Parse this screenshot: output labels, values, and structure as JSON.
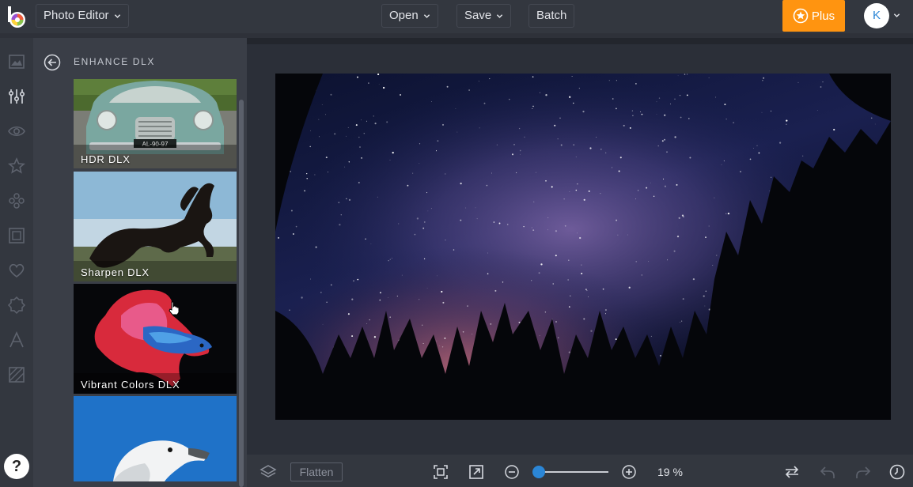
{
  "header": {
    "app_menu_label": "Photo Editor",
    "open_label": "Open",
    "save_label": "Save",
    "batch_label": "Batch",
    "plus_label": "Plus",
    "avatar_initial": "K"
  },
  "sidebar": {
    "icons": [
      "image-icon",
      "adjust-sliders-icon",
      "eye-icon",
      "star-icon",
      "overlay-dots-icon",
      "frame-icon",
      "heart-icon",
      "badge-icon",
      "text-icon",
      "texture-icon"
    ],
    "help_label": "?"
  },
  "panel": {
    "title": "ENHANCE DLX",
    "items": [
      {
        "label": "HDR DLX"
      },
      {
        "label": "Sharpen DLX"
      },
      {
        "label": "Vibrant Colors DLX"
      },
      {
        "label": ""
      }
    ]
  },
  "bottombar": {
    "flatten_label": "Flatten",
    "zoom_text": "19 %",
    "zoom_percent": 19
  },
  "colors": {
    "accent": "#ff9410",
    "slider": "#2b86d6",
    "chrome": "#33373f",
    "panel": "#3a3e47"
  }
}
